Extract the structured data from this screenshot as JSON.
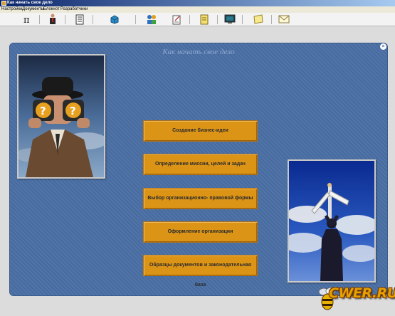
{
  "window": {
    "title": "Как начать свое дело"
  },
  "menu": [
    "Настройки",
    "Документы",
    "Блокнот",
    "Разработчики"
  ],
  "toolbar": {
    "icons": [
      "pi-icon",
      "person-icon",
      "document-icon",
      "cube-icon",
      "people-icon",
      "notepad-icon",
      "note-icon",
      "monitor-icon",
      "sticky-note-icon",
      "envelope-icon"
    ]
  },
  "main": {
    "heading": "Как начать свое дело",
    "close_label": "×",
    "buttons": [
      "Создание бизнес-идеи",
      "Определение миссии, целей и задач",
      "Выбор организационно- правовой формы",
      "Оформление организации",
      "Образцы документов и законодательная база"
    ]
  },
  "watermark": {
    "text": "CWER.RU"
  },
  "colors": {
    "panel": "#4a6fa5",
    "button": "#dc9417",
    "titlebar": "#0a246a"
  }
}
